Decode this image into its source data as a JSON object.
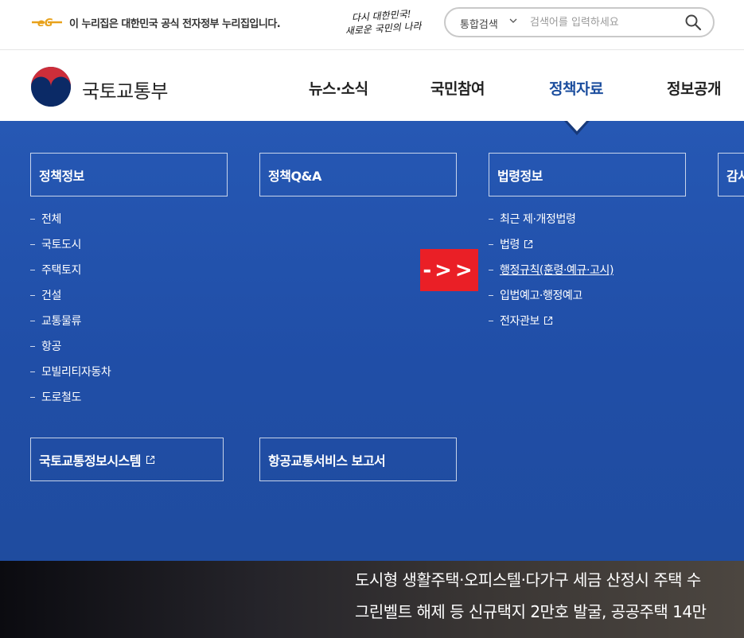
{
  "govbar": {
    "notice": "이 누리집은 대한민국 공식 전자정부 누리집입니다.",
    "slogan_line1": "다시 대한민국!",
    "slogan_line2": "새로운 국민의 나라",
    "search_scope": "통합검색",
    "search_placeholder": "검색어를 입력하세요"
  },
  "header": {
    "ministry_name": "국토교통부",
    "nav": [
      {
        "label": "뉴스·소식"
      },
      {
        "label": "국민참여"
      },
      {
        "label": "정책자료",
        "active": true
      },
      {
        "label": "정보공개"
      }
    ]
  },
  "mega_menu": {
    "col1": {
      "title": "정책정보",
      "items": [
        "전체",
        "국토도시",
        "주택토지",
        "건설",
        "교통물류",
        "항공",
        "모빌리티자동차",
        "도로철도"
      ],
      "bottom_box": "국토교통정보시스템"
    },
    "col2": {
      "title": "정책Q&A",
      "bottom_box": "항공교통서비스 보고서"
    },
    "col3": {
      "title": "법령정보",
      "items": [
        "최근 제·개정법령",
        "법령",
        "행정규칙(훈령·예규·고시)",
        "입법예고·행정예고",
        "전자관보"
      ]
    },
    "col4": {
      "title": "감사"
    },
    "arrow_label": "->>"
  },
  "hero": {
    "line1": "도시형 생활주택·오피스텔·다가구 세금 산정시 주택 수",
    "line2": "그린벨트 해제 등 신규택지 2만호 발굴, 공공주택 14만"
  },
  "colors": {
    "menu_blue": "#2357b2",
    "active_nav": "#1c4e9e",
    "arrow_red": "#ea1f26"
  },
  "icons": [
    "eg-logo-icon",
    "chevron-down-icon",
    "search-icon",
    "ministry-emblem-icon",
    "external-link-icon",
    "menu-pointer-icon"
  ]
}
